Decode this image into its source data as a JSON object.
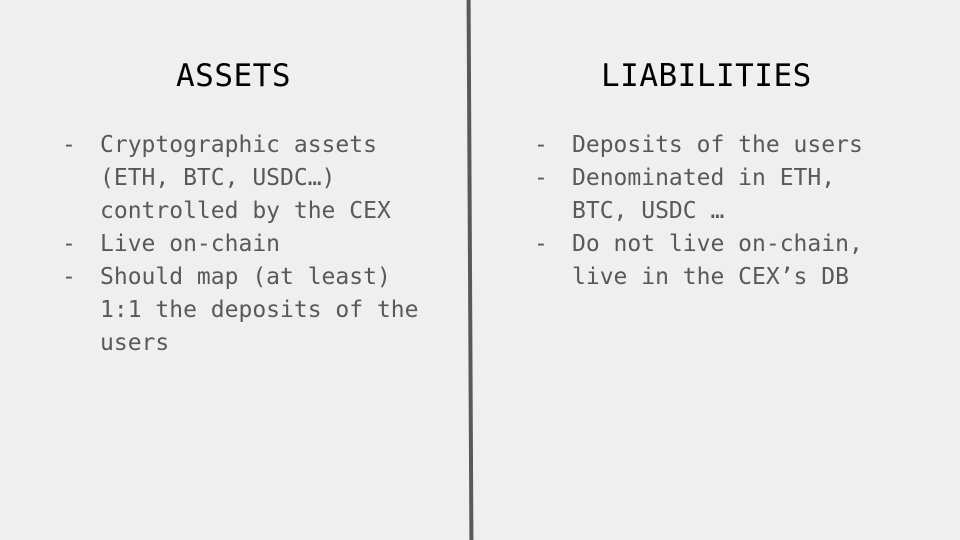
{
  "slide": {
    "columns": [
      {
        "heading": "ASSETS",
        "bullet": "-",
        "items": [
          "Cryptographic assets\n(ETH, BTC, USDC…)\ncontrolled by the CEX",
          "Live on-chain",
          "Should map (at least)\n1:1 the deposits of the\nusers"
        ]
      },
      {
        "heading": "LIABILITIES",
        "bullet": "-",
        "items": [
          "Deposits of the users",
          "Denominated in ETH,\nBTC, USDC …",
          "Do not live on-chain,\nlive in the CEX’s DB"
        ]
      }
    ],
    "colors": {
      "background": "#efefef",
      "heading": "#000000",
      "body_text": "#595959",
      "divider": "#595959"
    }
  }
}
